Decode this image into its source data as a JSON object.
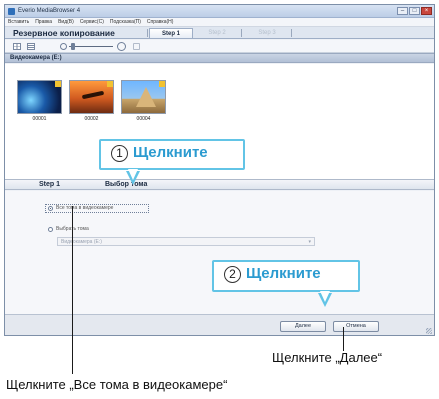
{
  "window": {
    "title": "Everio MediaBrowser 4",
    "controls": {
      "minimize": "–",
      "maximize": "□",
      "close": "×"
    }
  },
  "menu": [
    "Вставить",
    "Правка",
    "Вид(В)",
    "Сервис(C)",
    "Подсказка(П)",
    "Справка(Н)"
  ],
  "tabs": {
    "main": "Резервное копирование",
    "steps": [
      "Step 1",
      "Step 2",
      "Step 3"
    ]
  },
  "source": {
    "label": "Видеокамера (E:)"
  },
  "thumbnails": [
    {
      "caption": "00001"
    },
    {
      "caption": "00002"
    },
    {
      "caption": "00004"
    }
  ],
  "steps_bar": {
    "step": "Step 1",
    "title": "Выбор тома"
  },
  "options": {
    "all_label": "Все тома в видеокамере",
    "select_label": "Выбрать тома",
    "select_value": "Видеокамера (E:)",
    "select_arrow": "▾"
  },
  "buttons": {
    "next": "Далее",
    "cancel": "Отмена"
  },
  "callouts": [
    {
      "number": "1",
      "text": "Щелкните"
    },
    {
      "number": "2",
      "text": "Щелкните"
    }
  ],
  "captions": {
    "next": "Щелкните „Далее“",
    "all": "Щелкните „Все тома в видеокамере“"
  },
  "colors": {
    "accent": "#2b9bd0",
    "callout_border": "#62c4e6",
    "close_button": "#c9463d",
    "thumb_flag": "#f2c230"
  }
}
